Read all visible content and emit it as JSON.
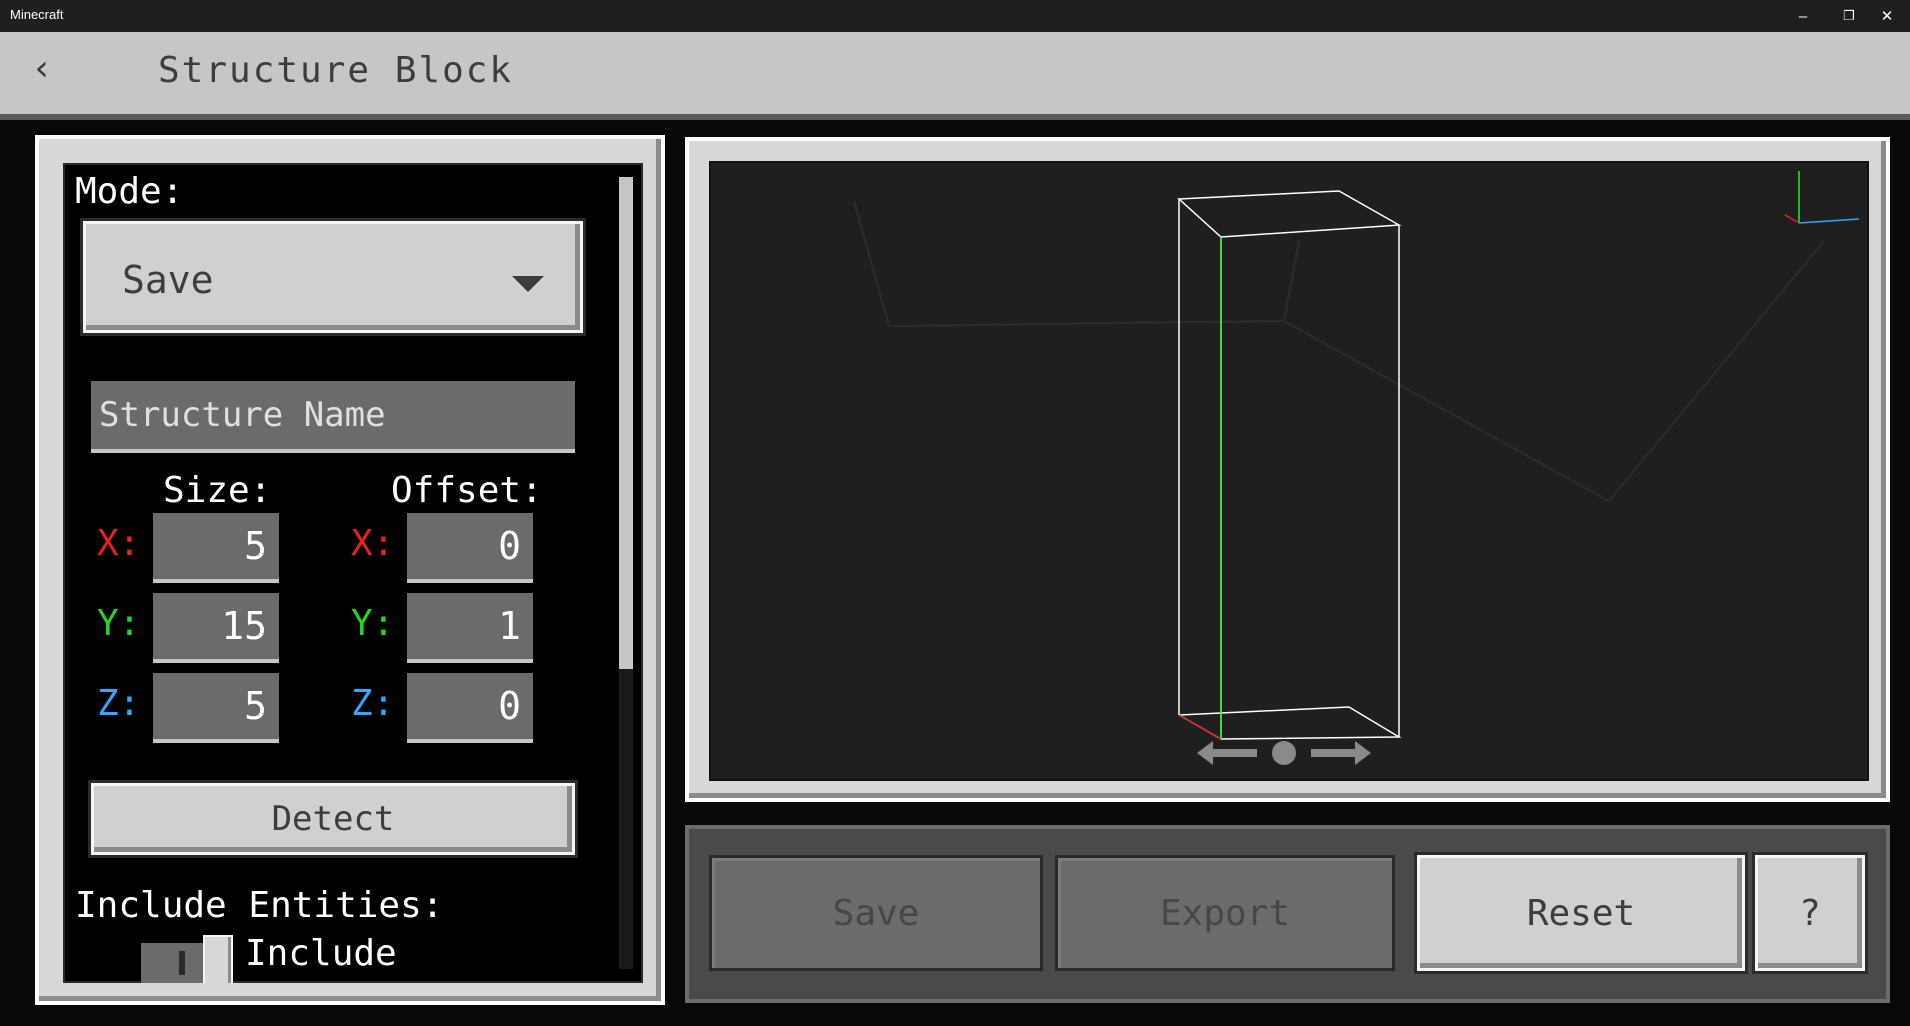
{
  "window": {
    "title": "Minecraft",
    "minimize": "–",
    "restore": "❐",
    "close": "✕"
  },
  "header": {
    "back_icon": "‹",
    "title": "Structure Block"
  },
  "settings": {
    "mode_label": "Mode:",
    "mode_value": "Save",
    "structure_name_placeholder": "Structure Name",
    "size_label": "Size:",
    "offset_label": "Offset:",
    "axes": {
      "x": {
        "label": "X:",
        "color": "#e82020"
      },
      "y": {
        "label": "Y:",
        "color": "#20d820"
      },
      "z": {
        "label": "Z:",
        "color": "#2ea8ff"
      }
    },
    "size": {
      "x": "5",
      "y": "15",
      "z": "5"
    },
    "offset": {
      "x": "0",
      "y": "1",
      "z": "0"
    },
    "detect_label": "Detect",
    "include_entities_label": "Include Entities:",
    "include_toggle_label": "Include"
  },
  "actions": {
    "save_label": "Save",
    "export_label": "Export",
    "reset_label": "Reset",
    "help_label": "?"
  }
}
